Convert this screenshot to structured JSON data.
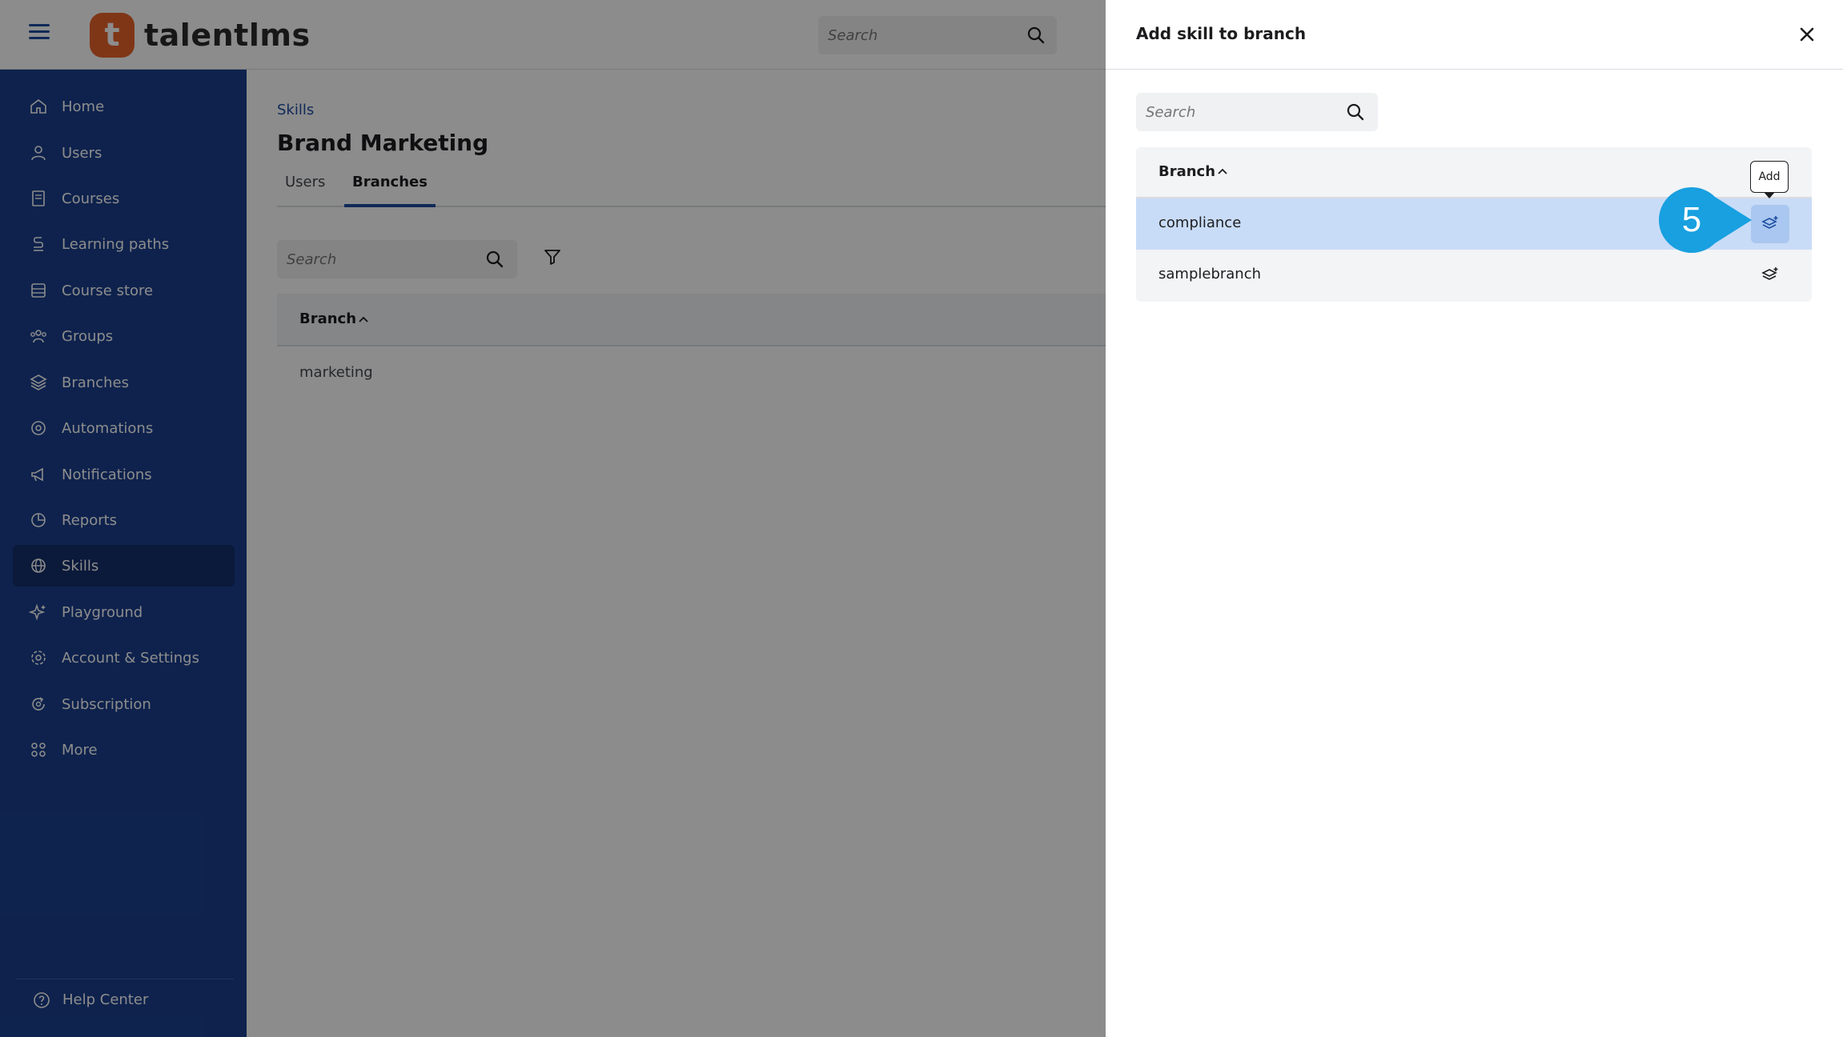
{
  "app": {
    "logo_letter": "t",
    "logo_text": "talentlms",
    "search_placeholder": "Search"
  },
  "sidebar": {
    "items": [
      {
        "label": "Home",
        "icon": "home-icon"
      },
      {
        "label": "Users",
        "icon": "user-icon"
      },
      {
        "label": "Courses",
        "icon": "book-icon"
      },
      {
        "label": "Learning paths",
        "icon": "path-icon"
      },
      {
        "label": "Course store",
        "icon": "store-icon"
      },
      {
        "label": "Groups",
        "icon": "groups-icon"
      },
      {
        "label": "Branches",
        "icon": "layers-icon"
      },
      {
        "label": "Automations",
        "icon": "automation-icon"
      },
      {
        "label": "Notifications",
        "icon": "megaphone-icon"
      },
      {
        "label": "Reports",
        "icon": "pie-chart-icon"
      },
      {
        "label": "Skills",
        "icon": "globe-icon"
      },
      {
        "label": "Playground",
        "icon": "sparkles-icon"
      },
      {
        "label": "Account & Settings",
        "icon": "gear-icon"
      },
      {
        "label": "Subscription",
        "icon": "refresh-icon"
      },
      {
        "label": "More",
        "icon": "grid-icon"
      }
    ],
    "active": "Skills",
    "help_center": "Help Center"
  },
  "main": {
    "breadcrumb": "Skills",
    "title": "Brand Marketing",
    "tabs": [
      {
        "label": "Users"
      },
      {
        "label": "Branches"
      }
    ],
    "active_tab": "Branches",
    "search_placeholder": "Search",
    "table": {
      "header": "Branch",
      "rows": [
        "marketing"
      ]
    }
  },
  "panel": {
    "title": "Add skill to branch",
    "search_placeholder": "Search",
    "table": {
      "header": "Branch",
      "rows": [
        {
          "name": "compliance",
          "selected": true
        },
        {
          "name": "samplebranch",
          "selected": false
        }
      ]
    },
    "tooltip": "Add",
    "step_number": "5"
  },
  "colors": {
    "sidebar_bg": "#1a3f8c",
    "sidebar_active": "#142f6b",
    "accent": "#1e4da1",
    "logo": "#e8632b",
    "selected_row": "#c9dcf7",
    "step_badge": "#18a0e0"
  }
}
